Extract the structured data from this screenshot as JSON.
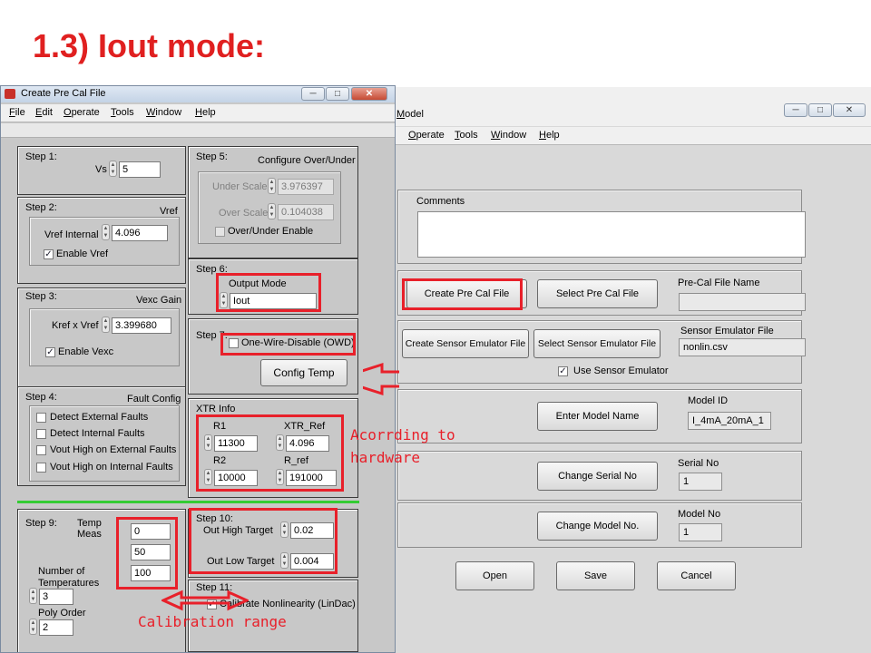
{
  "slide_title": "1.3) Iout mode:",
  "colors": {
    "annotation": "#e8202a",
    "title": "#e02020"
  },
  "right_window": {
    "title": "Model",
    "menu": [
      "Operate",
      "Tools",
      "Window",
      "Help"
    ],
    "window_buttons": {
      "minimize": "─",
      "maximize": "□",
      "close": "✕"
    },
    "comments_label": "Comments",
    "comments_value": "",
    "create_pre_cal_button": "Create Pre Cal File",
    "select_pre_cal_button": "Select Pre Cal File",
    "pre_cal_name_label": "Pre-Cal File Name",
    "pre_cal_name_value": "",
    "create_sensor_emulator_button": "Create Sensor Emulator File",
    "select_sensor_emulator_button": "Select Sensor Emulator File",
    "sensor_emulator_label": "Sensor Emulator File",
    "sensor_emulator_value": "nonlin.csv",
    "use_sensor_emulator_label": "Use Sensor Emulator",
    "use_sensor_emulator_checked": true,
    "enter_model_name_button": "Enter Model Name",
    "model_id_label": "Model ID",
    "model_id_value": "I_4mA_20mA_1",
    "change_serial_button": "Change Serial No",
    "serial_label": "Serial No",
    "serial_value": "1",
    "change_model_button": "Change Model No.",
    "model_no_label": "Model No",
    "model_no_value": "1",
    "open_button": "Open",
    "save_button": "Save",
    "cancel_button": "Cancel"
  },
  "left_window": {
    "title": "Create Pre Cal File",
    "menu": [
      "File",
      "Edit",
      "Operate",
      "Tools",
      "Window",
      "Help"
    ],
    "window_buttons": {
      "minimize": "─",
      "maximize": "□",
      "close": "✕"
    },
    "step1": {
      "label": "Step 1:",
      "vs_label": "Vs",
      "vs_value": "5"
    },
    "step2": {
      "label": "Step 2:",
      "title": "Vref",
      "vref_label": "Vref Internal",
      "vref_value": "4.096",
      "enable_label": "Enable Vref",
      "enable_checked": true
    },
    "step3": {
      "label": "Step 3:",
      "title": "Vexc Gain",
      "kref_label": "Kref x Vref",
      "kref_value": "3.399680",
      "enable_label": "Enable Vexc",
      "enable_checked": true
    },
    "step4": {
      "label": "Step 4:",
      "title": "Fault Config",
      "options": [
        "Detect External Faults",
        "Detect Internal Faults",
        "Vout High on External Faults",
        "Vout High on Internal Faults"
      ]
    },
    "step5": {
      "label": "Step 5:",
      "title": "Configure Over/Under",
      "under_label": "Under Scale",
      "under_value": "3.976397",
      "over_label": "Over Scale",
      "over_value": "0.104038",
      "enable_label": "Over/Under Enable"
    },
    "step6": {
      "label": "Step 6:",
      "mode_label": "Output Mode",
      "mode_value": "Iout"
    },
    "step7": {
      "label": "Step 7:",
      "owd_label": "One-Wire-Disable (OWD)",
      "config_temp_button": "Config Temp"
    },
    "xtr": {
      "label": "XTR Info",
      "r1_label": "R1",
      "r1_value": "11300",
      "xtr_ref_label": "XTR_Ref",
      "xtr_ref_value": "4.096",
      "r2_label": "R2",
      "r2_value": "10000",
      "r_ref_label": "R_ref",
      "r_ref_value": "191000"
    },
    "step9": {
      "label": "Step 9:",
      "temp_label_1": "Temp",
      "temp_label_2": "Meas",
      "temps": [
        "0",
        "50",
        "100"
      ],
      "num_temps_label_1": "Number of",
      "num_temps_label_2": "Temperatures",
      "num_temps_value": "3",
      "poly_label": "Poly Order",
      "poly_value": "2"
    },
    "step10": {
      "label": "Step 10:",
      "high_label": "Out High Target",
      "high_value": "0.02",
      "low_label": "Out Low Target",
      "low_value": "0.004"
    },
    "step11": {
      "label": "Step 11:",
      "calibrate_label": "Calibrate Nonlinearity (LinDac)",
      "calibrate_checked": true
    }
  },
  "annotations": {
    "hardware_1": "Acorrding to",
    "hardware_2": "hardware",
    "calibration": "Calibration range"
  }
}
